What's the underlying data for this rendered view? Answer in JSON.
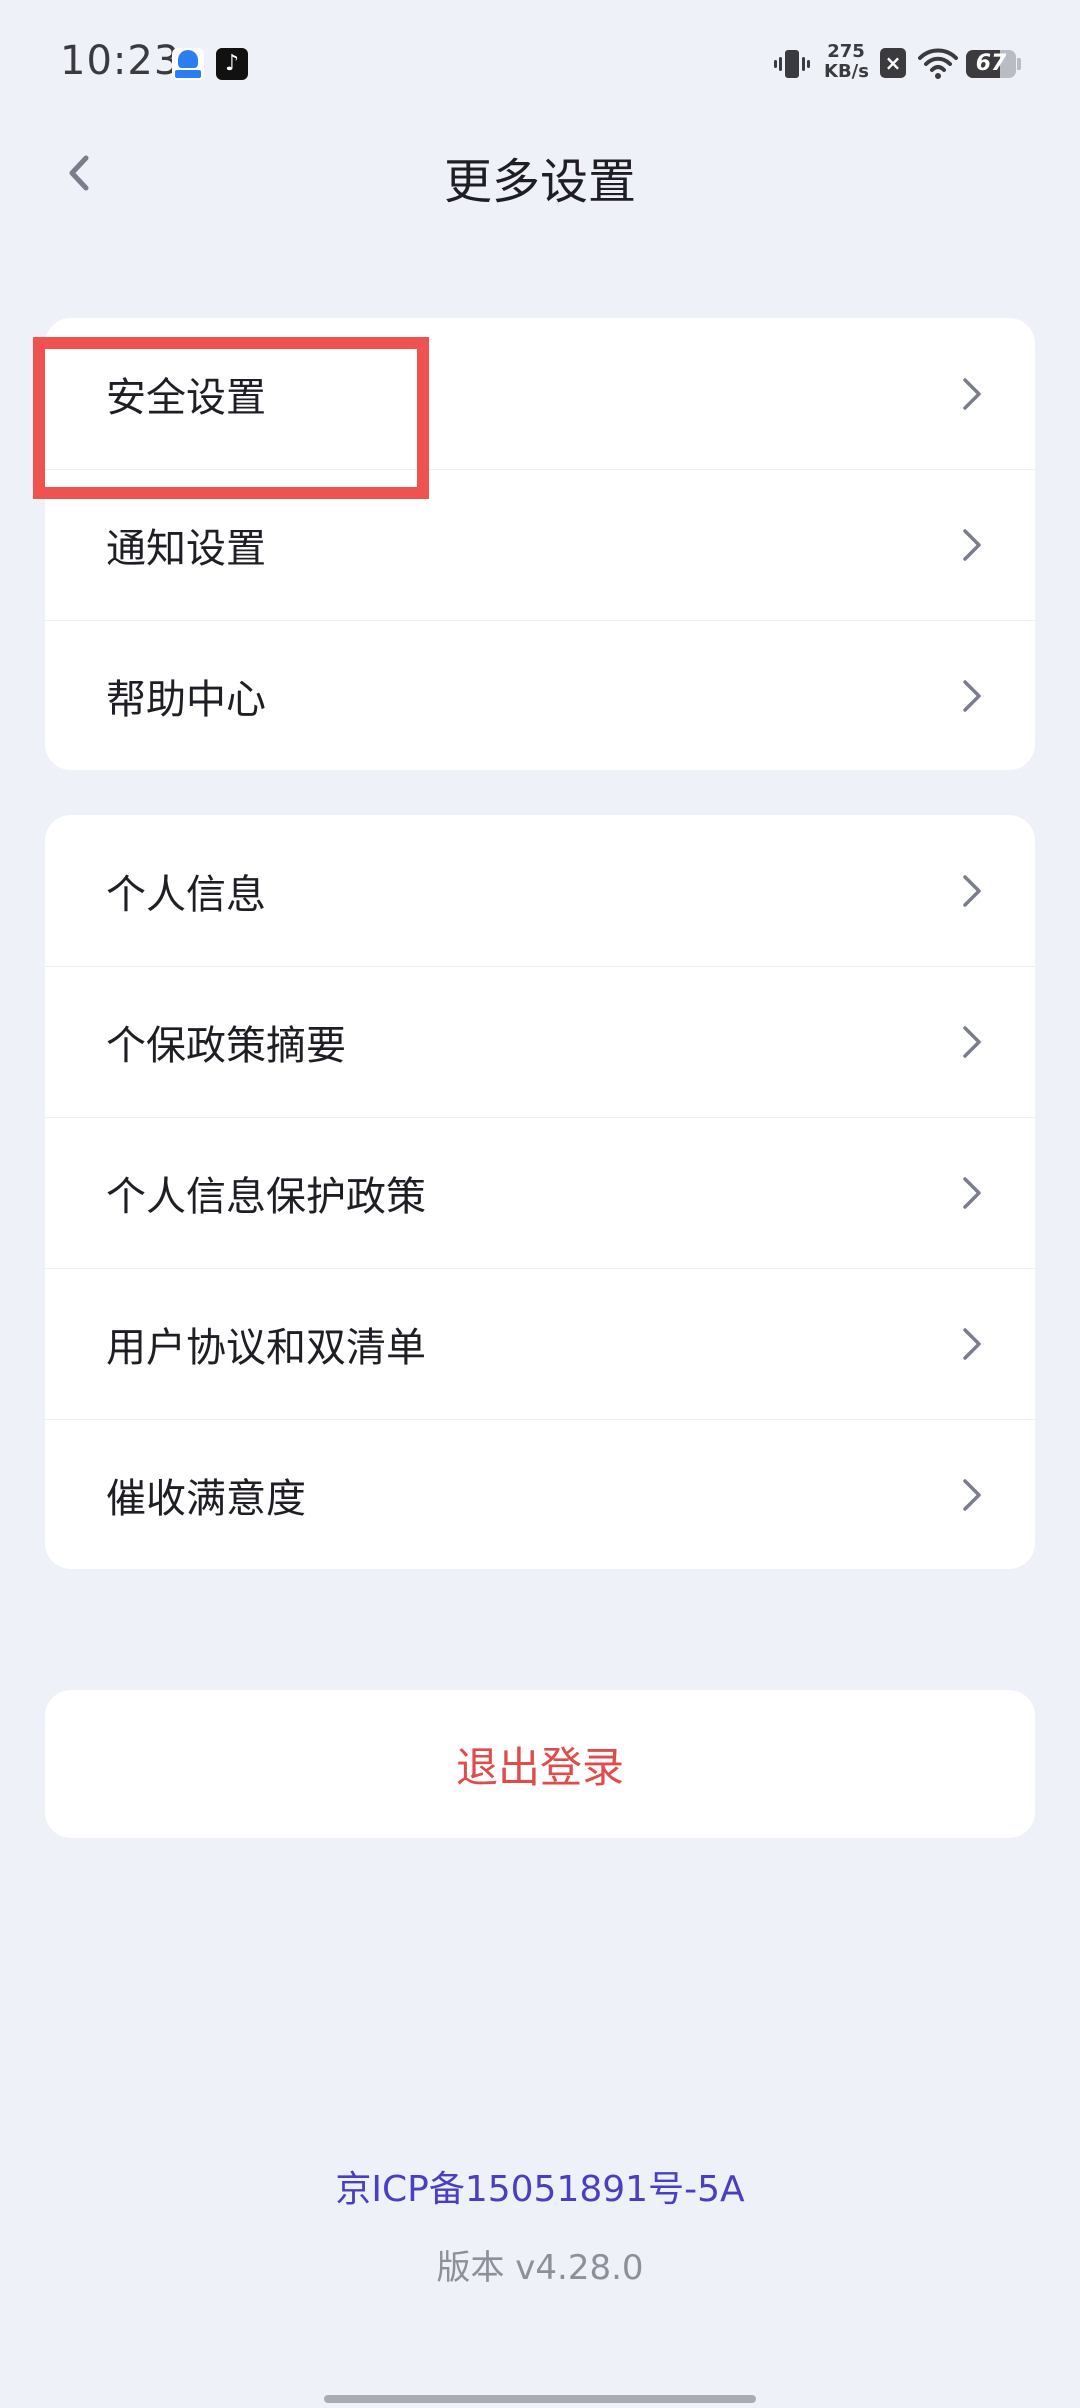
{
  "status_bar": {
    "time": "10:23",
    "net_speed": "275\nKB/s",
    "net_speed_value": "275",
    "net_speed_unit": "KB/s",
    "battery": "67",
    "battery_level": 0.67,
    "icons": [
      "app-notification-icon",
      "tiktok-icon",
      "vibrate-icon",
      "x-app-icon",
      "wifi-icon",
      "battery-icon"
    ]
  },
  "header": {
    "title": "更多设置",
    "back_icon": "chevron-left-icon"
  },
  "groups": [
    {
      "items": [
        {
          "label": "安全设置"
        },
        {
          "label": "通知设置"
        },
        {
          "label": "帮助中心"
        }
      ]
    },
    {
      "items": [
        {
          "label": "个人信息"
        },
        {
          "label": "个保政策摘要"
        },
        {
          "label": "个人信息保护政策"
        },
        {
          "label": "用户协议和双清单"
        },
        {
          "label": "催收满意度"
        }
      ]
    }
  ],
  "logout": {
    "label": "退出登录",
    "color": "#e04b4b"
  },
  "footer": {
    "icp": "京ICP备15051891号-5A",
    "version": "版本 v4.28.0"
  },
  "colors": {
    "background": "#eef1f8",
    "card": "#ffffff",
    "highlight": "#ef5350",
    "link": "#4a3fc2",
    "chevron": "#7a7e8a"
  }
}
